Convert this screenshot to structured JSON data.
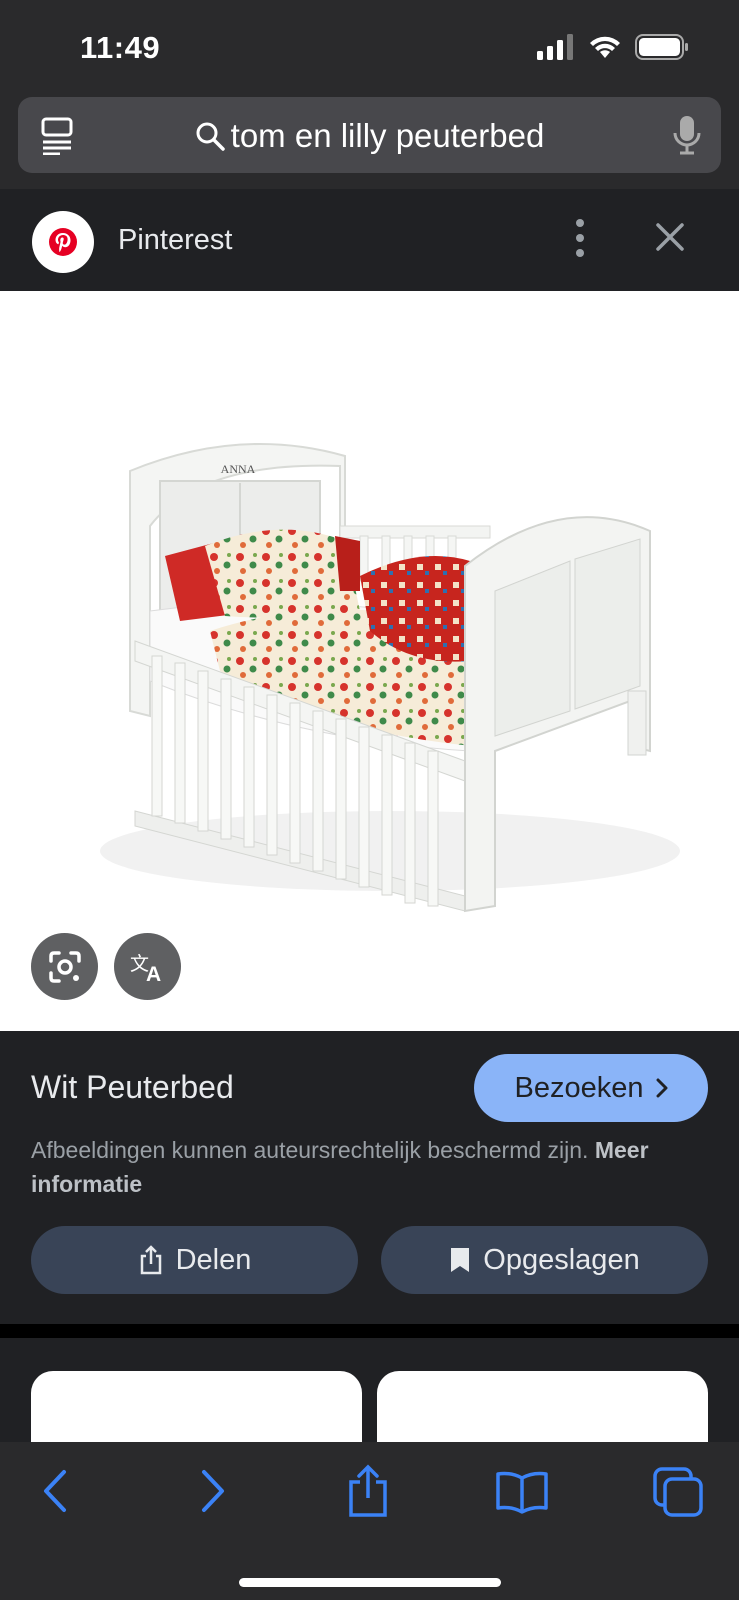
{
  "status": {
    "time": "11:49"
  },
  "search": {
    "query": "tom en lilly peuterbed"
  },
  "source": {
    "name": "Pinterest"
  },
  "product": {
    "engraving": "ANNA"
  },
  "info": {
    "title": "Wit Peuterbed",
    "visit_label": "Bezoeken",
    "copyright_text": "Afbeeldingen kunnen auteursrechtelijk beschermd zijn.",
    "more_info_label": "Meer informatie",
    "share_label": "Delen",
    "saved_label": "Opgeslagen"
  },
  "colors": {
    "accent": "#8ab4f8",
    "toolbar_icon": "#3b82f6",
    "pinterest": "#e60023"
  },
  "icons": {
    "tabs": "tabs-icon",
    "search": "search-icon",
    "mic": "mic-icon",
    "menu": "more-vert-icon",
    "close": "close-icon",
    "lens": "lens-icon",
    "translate": "translate-icon",
    "back": "back-icon",
    "forward": "forward-icon",
    "share": "share-icon",
    "bookmarks": "bookmarks-icon",
    "tab_switcher": "tab-switcher-icon"
  }
}
